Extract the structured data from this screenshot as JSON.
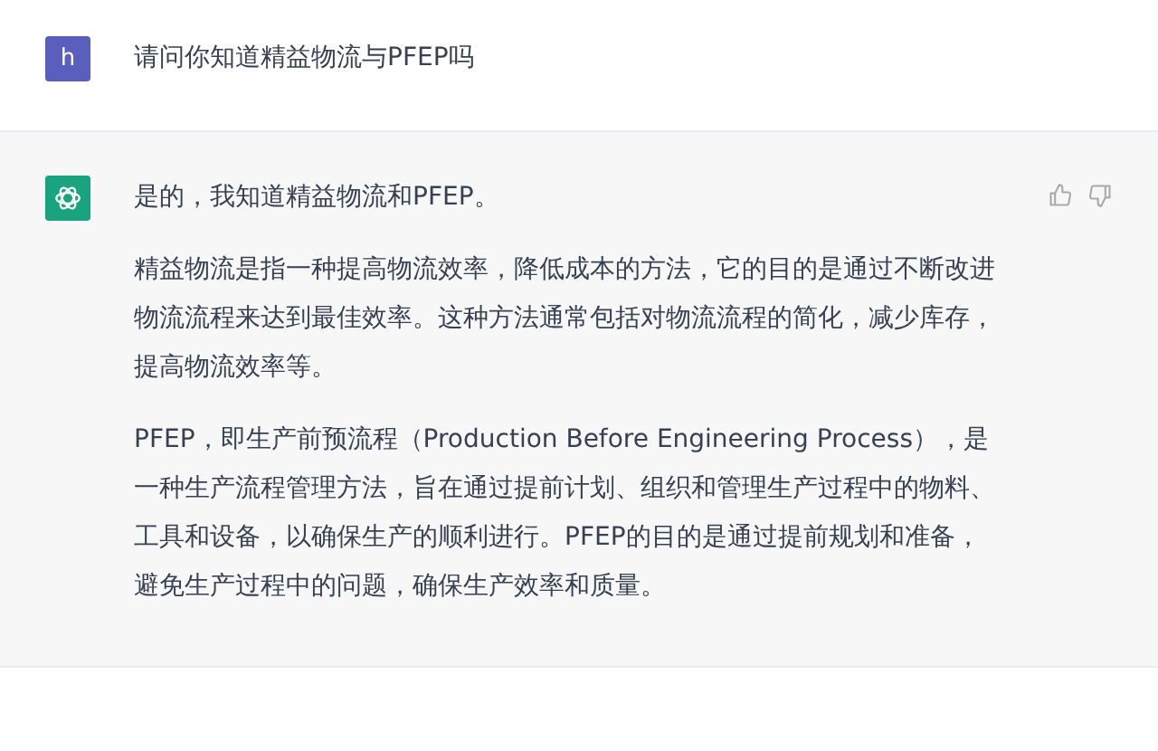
{
  "messages": [
    {
      "kind": "user",
      "avatar": "h",
      "paragraphs": [
        "请问你知道精益物流与PFEP吗"
      ]
    },
    {
      "kind": "assistant",
      "paragraphs": [
        "是的，我知道精益物流和PFEP。",
        "精益物流是指一种提高物流效率，降低成本的方法，它的目的是通过不断改进物流流程来达到最佳效率。这种方法通常包括对物流流程的简化，减少库存，提高物流效率等。",
        "PFEP，即生产前预流程（Production Before Engineering Process），是一种生产流程管理方法，旨在通过提前计划、组织和管理生产过程中的物料、工具和设备，以确保生产的顺利进行。PFEP的目的是通过提前规划和准备，避免生产过程中的问题，确保生产效率和质量。"
      ]
    }
  ]
}
